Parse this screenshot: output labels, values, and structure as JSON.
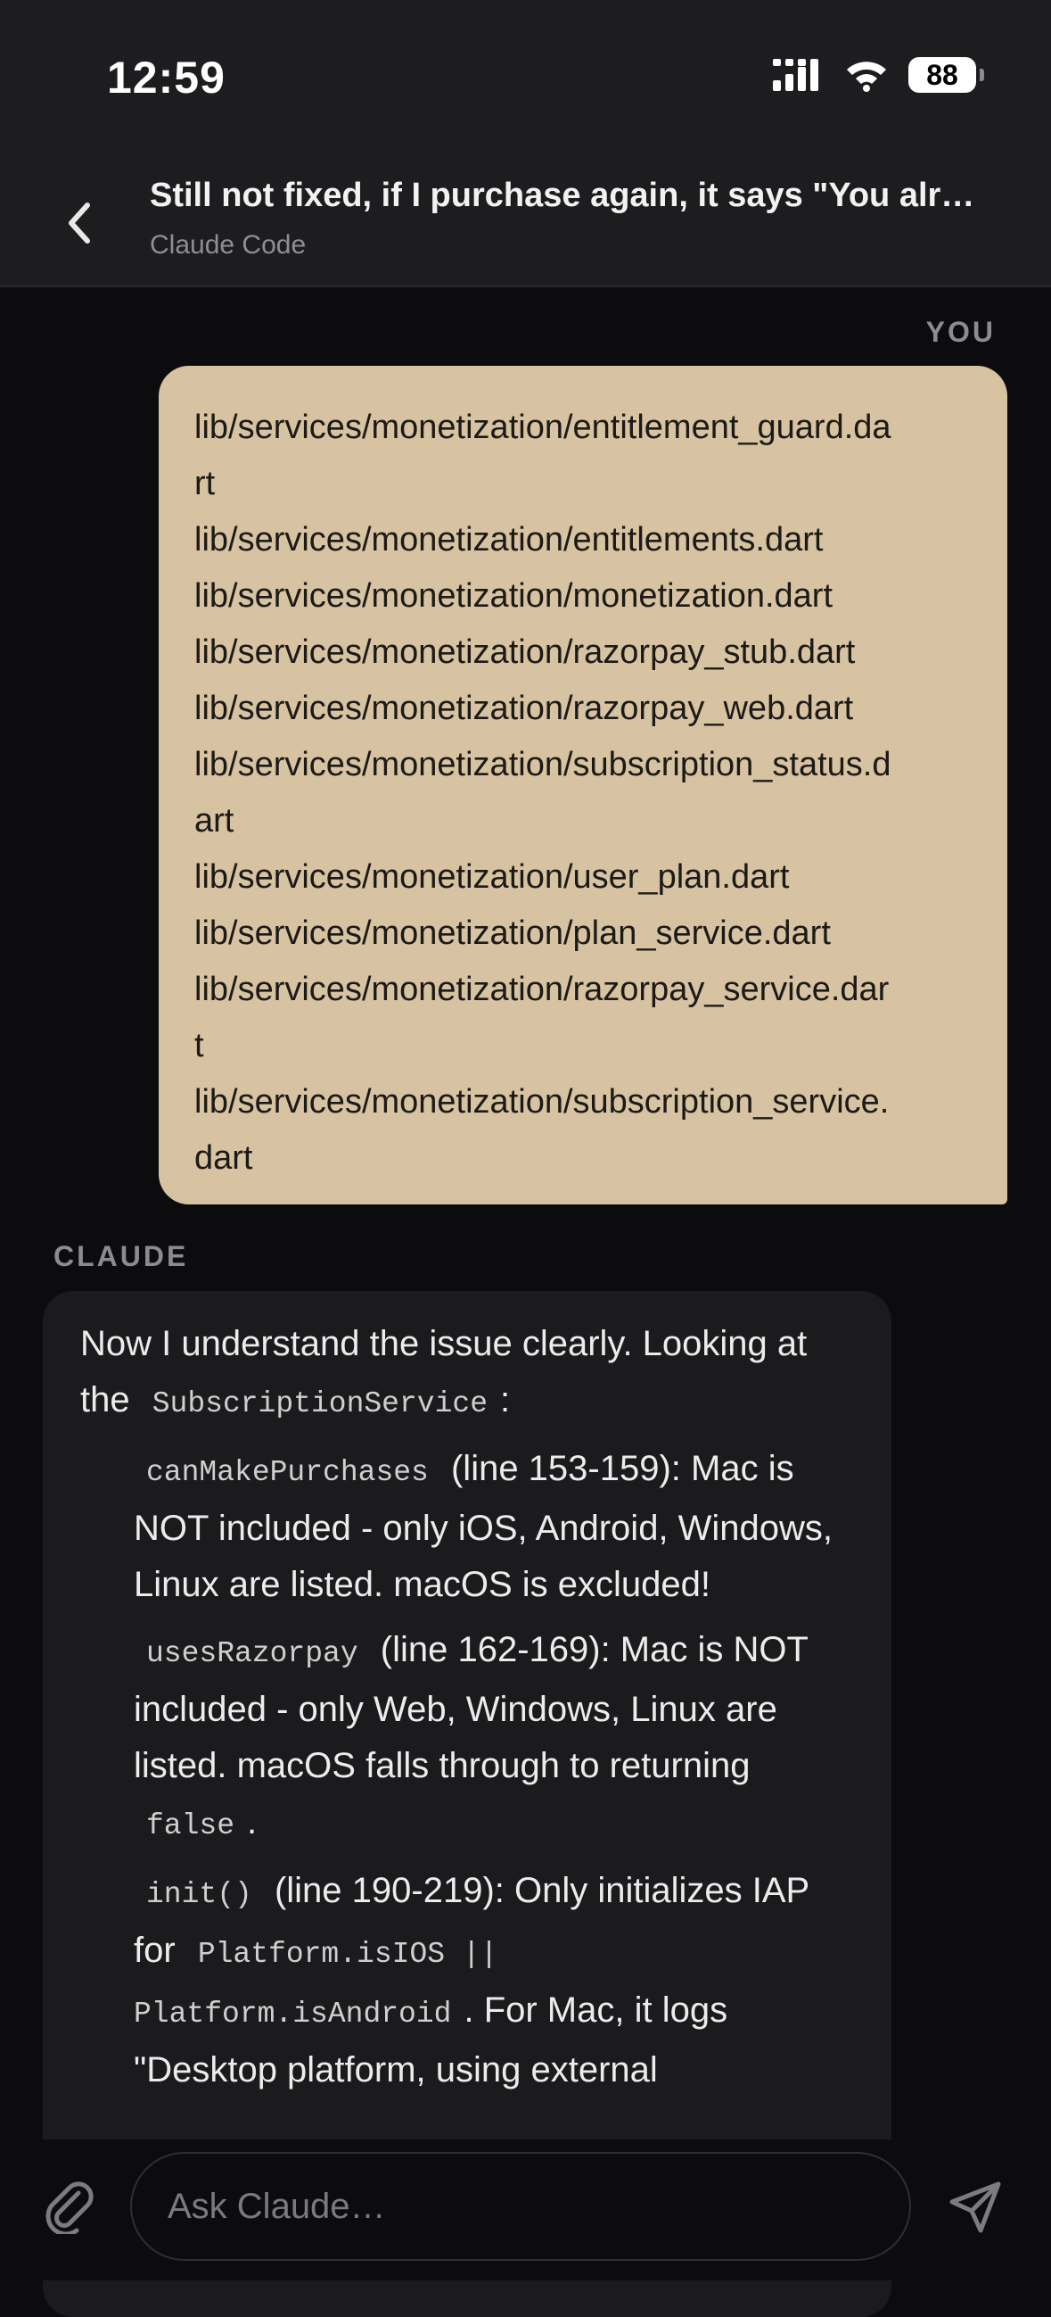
{
  "status_bar": {
    "time": "12:59",
    "battery": "88"
  },
  "header": {
    "title": "Still not fixed, if I purchase again, it says \"You alr…",
    "subtitle": "Claude Code"
  },
  "messages": {
    "user_label": "YOU",
    "user_lines": [
      "lib/services/monetization/entitlement_guard.da",
      "rt",
      "lib/services/monetization/entitlements.dart",
      "lib/services/monetization/monetization.dart",
      "lib/services/monetization/razorpay_stub.dart",
      "lib/services/monetization/razorpay_web.dart",
      "lib/services/monetization/subscription_status.d",
      "art",
      "lib/services/monetization/user_plan.dart",
      "lib/services/monetization/plan_service.dart",
      "lib/services/monetization/razorpay_service.dar",
      "t",
      "lib/services/monetization/subscription_service.",
      "dart"
    ],
    "claude_label": "CLAUDE",
    "claude": {
      "intro": "Now I understand the issue clearly. Looking at the",
      "intro_code": "SubscriptionService",
      "intro_end": ":",
      "b1_code": "canMakePurchases",
      "b1_text": "(line 153-159): Mac is NOT included - only iOS, Android, Windows, Linux are listed. macOS is excluded!",
      "b2_code": "usesRazorpay",
      "b2_text": "(line 162-169): Mac is NOT included - only Web, Windows, Linux are listed. macOS falls through to returning",
      "b2_code2": "false",
      "b2_end": ".",
      "b3_code": "init()",
      "b3_text": "(line 190-219): Only initializes IAP for",
      "b3_code2": "Platform.isIOS ||",
      "b3_code3": "Platform.isAndroid",
      "b3_text2": ". For Mac, it logs \"Desktop platform, using external"
    }
  },
  "composer": {
    "placeholder": "Ask Claude…"
  },
  "icons": {
    "back": "chevron-left-icon",
    "attach": "paperclip-icon",
    "send": "send-icon",
    "signal": "signal-icon",
    "wifi": "wifi-icon",
    "battery": "battery-icon"
  }
}
